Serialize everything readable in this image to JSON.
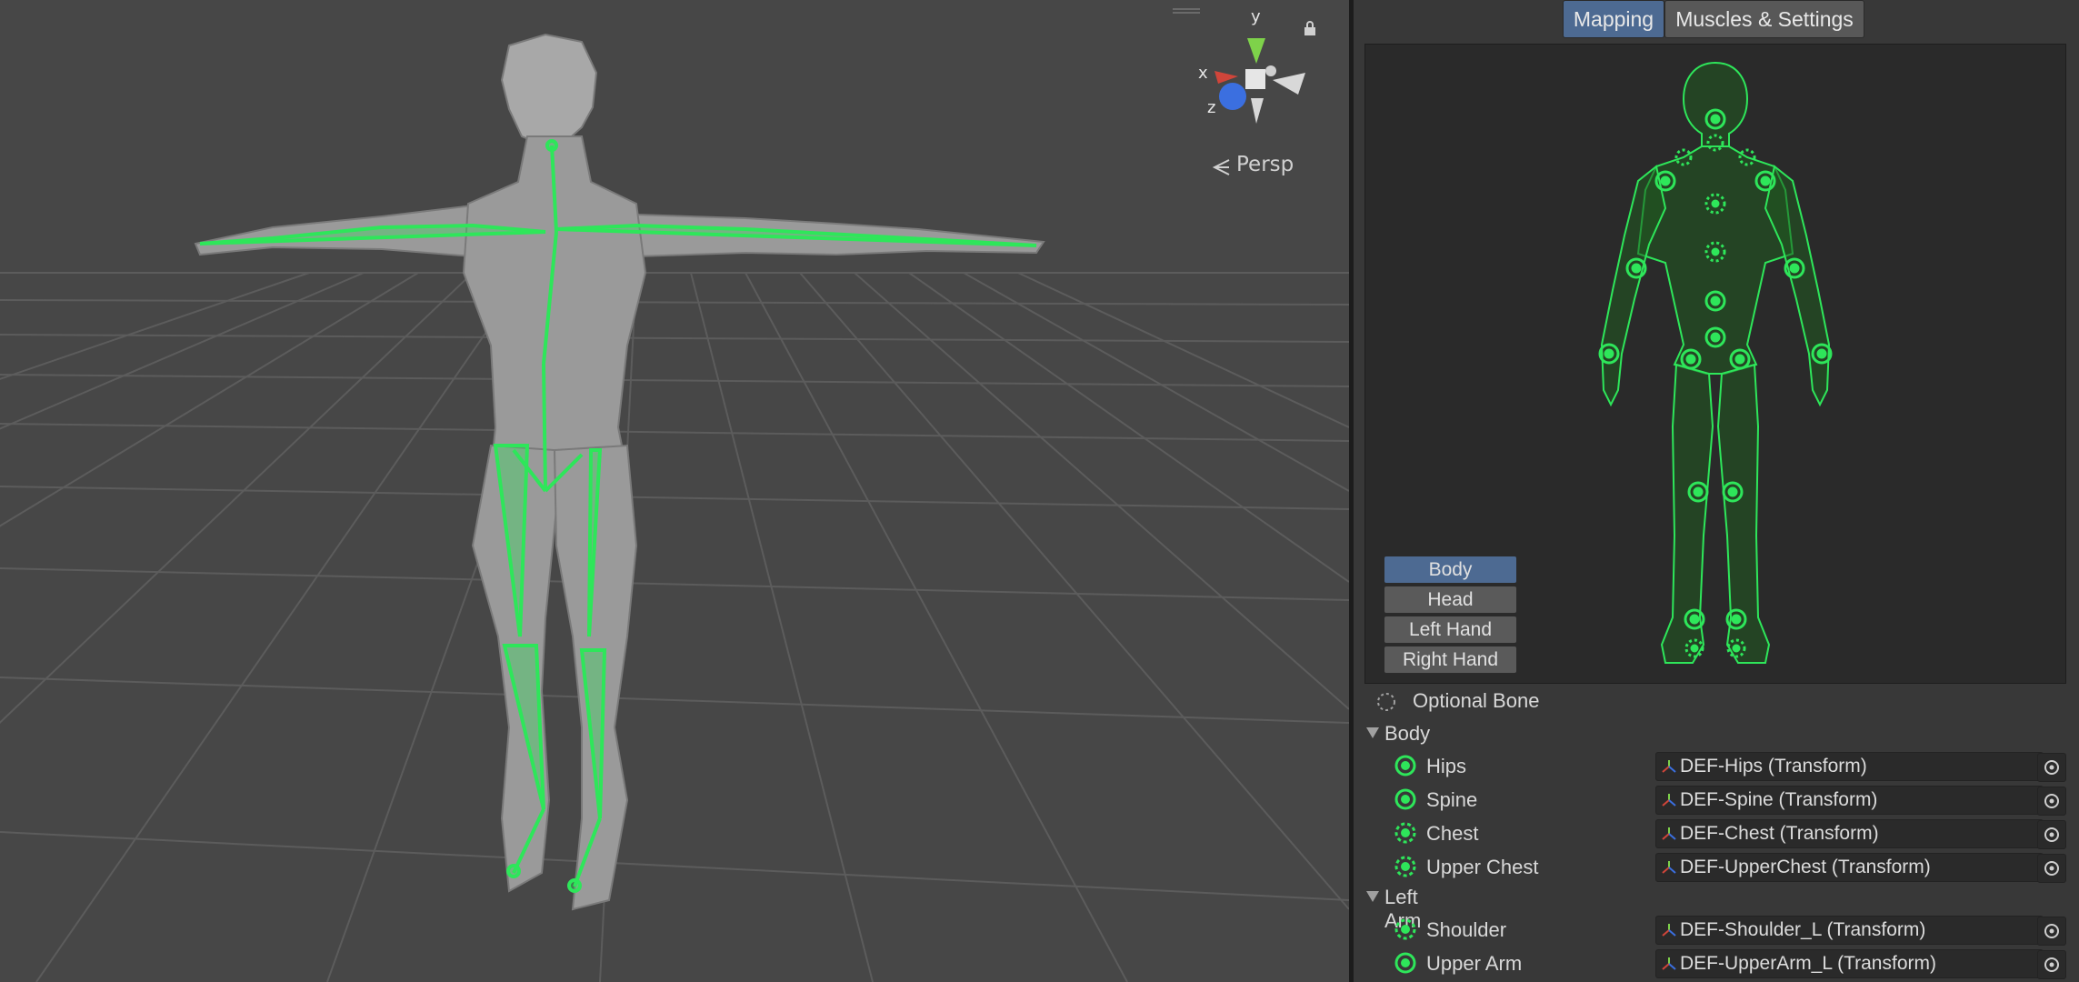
{
  "scene": {
    "projection_label": "Persp",
    "gizmo_axes": {
      "x": "x",
      "y": "y",
      "z": "z"
    },
    "colors": {
      "bone": "#2ee65a",
      "mesh": "#9c9c9c",
      "grid": "#5c5c5c",
      "background": "#474747"
    },
    "icons": [
      "lock-icon",
      "orientation-gizmo-icon",
      "perspective-icon"
    ]
  },
  "inspector": {
    "tabs": [
      {
        "label": "Mapping",
        "active": true
      },
      {
        "label": "Muscles & Settings",
        "active": false
      }
    ],
    "preview_buttons": [
      {
        "label": "Body",
        "active": true
      },
      {
        "label": "Head",
        "active": false
      },
      {
        "label": "Left Hand",
        "active": false
      },
      {
        "label": "Right Hand",
        "active": false
      }
    ],
    "legend": {
      "label": "Optional Bone",
      "icon": "optional-bone-icon"
    },
    "sections": [
      {
        "title": "Body",
        "bones": [
          {
            "name": "Hips",
            "value": "DEF-Hips (Transform)",
            "optional": false
          },
          {
            "name": "Spine",
            "value": "DEF-Spine (Transform)",
            "optional": false
          },
          {
            "name": "Chest",
            "value": "DEF-Chest (Transform)",
            "optional": true
          },
          {
            "name": "Upper Chest",
            "value": "DEF-UpperChest (Transform)",
            "optional": true
          }
        ]
      },
      {
        "title": "Left Arm",
        "bones": [
          {
            "name": "Shoulder",
            "value": "DEF-Shoulder_L (Transform)",
            "optional": true
          },
          {
            "name": "Upper Arm",
            "value": "DEF-UpperArm_L (Transform)",
            "optional": false
          }
        ]
      }
    ],
    "colors": {
      "accent": "#4d6a92",
      "bone_green": "#2ee65a",
      "panel": "#383838"
    }
  }
}
